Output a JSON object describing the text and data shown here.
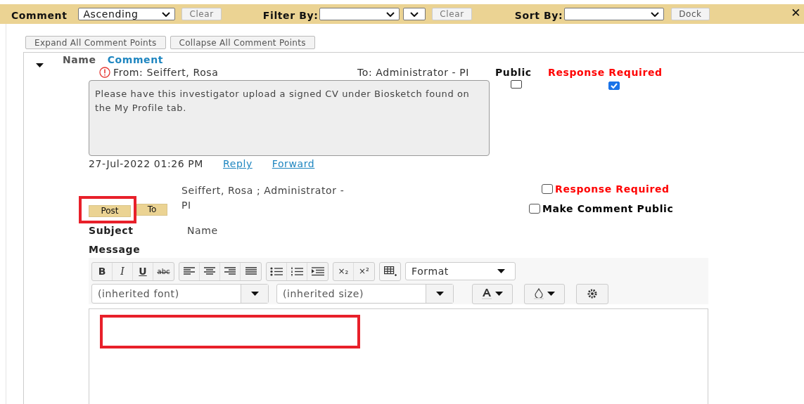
{
  "top_bar": {
    "title": "Comment",
    "order": "Ascending",
    "clear_order": "Clear",
    "filter_label": "Filter By:",
    "clear_filter": "Clear",
    "sort_label": "Sort By:",
    "dock": "Dock",
    "close": "✕"
  },
  "actions": [
    "Expand All Comment Points",
    "Collapse All Comment Points"
  ],
  "header": {
    "name": "Name",
    "comment": "Comment"
  },
  "comment": {
    "from": "From: Seiffert, Rosa",
    "to": "To: Administrator - PI",
    "public_label": "Public",
    "response_label": "Response Required",
    "public": false,
    "response_required": true,
    "text": "Please have this investigator upload a signed CV under Biosketch found on the My Profile tab.",
    "date": "27-Jul-2022 01:26 PM",
    "links": [
      "Reply",
      "Forward"
    ]
  },
  "reply": {
    "tabs": [
      "Post",
      "To"
    ],
    "recipients": "Seiffert, Rosa ; Administrator - PI",
    "response_label": "Response Required",
    "response_required": false,
    "public_label": "Make Comment Public",
    "make_public": false,
    "subject_label": "Subject",
    "subject": "Name",
    "message_label": "Message"
  },
  "editor": {
    "style_buttons": [
      "B",
      "I",
      "U",
      "abc"
    ],
    "script_buttons": [
      "×₂",
      "×²"
    ],
    "format": "Format",
    "font": "(inherited font)",
    "size": "(inherited size)"
  }
}
